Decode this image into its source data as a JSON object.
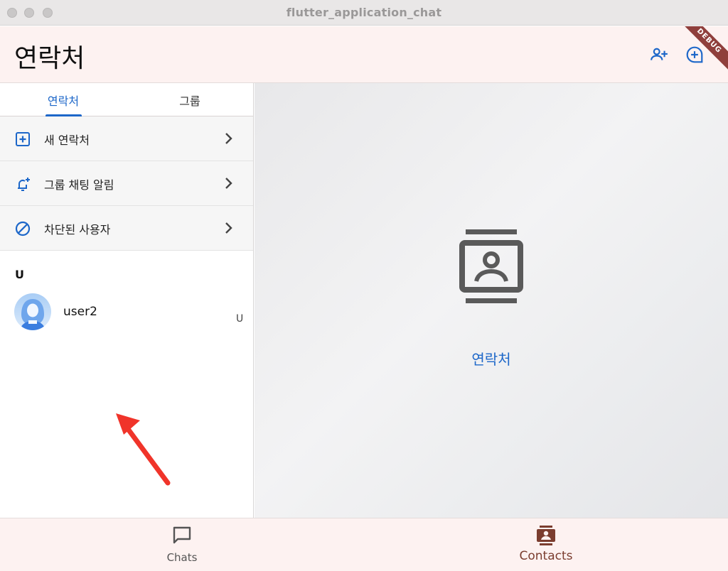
{
  "window": {
    "title": "flutter_application_chat"
  },
  "appbar": {
    "title": "연락처",
    "debug_banner": "DEBUG"
  },
  "tabs": [
    {
      "label": "연락처",
      "selected": true
    },
    {
      "label": "그룹",
      "selected": false
    }
  ],
  "menu": [
    {
      "label": "새 연락처",
      "icon": "add-box-icon"
    },
    {
      "label": "그룹 채팅 알림",
      "icon": "notification-add-icon"
    },
    {
      "label": "차단된 사용자",
      "icon": "block-icon"
    }
  ],
  "contacts": {
    "section": "U",
    "items": [
      {
        "name": "user2"
      }
    ],
    "index_letters": [
      "U"
    ]
  },
  "detail": {
    "label": "연락처",
    "icon": "contact-page-icon"
  },
  "bottom_nav": [
    {
      "label": "Chats",
      "icon": "chat-bubble-icon",
      "selected": false
    },
    {
      "label": "Contacts",
      "icon": "contacts-icon",
      "selected": true
    }
  ],
  "colors": {
    "accent": "#1d67c9",
    "appbar_bg": "#fdf2f1",
    "selected_nav": "#7b3d2f",
    "debug_ribbon": "#8f3f3c",
    "annotation_arrow": "#f0342a"
  }
}
